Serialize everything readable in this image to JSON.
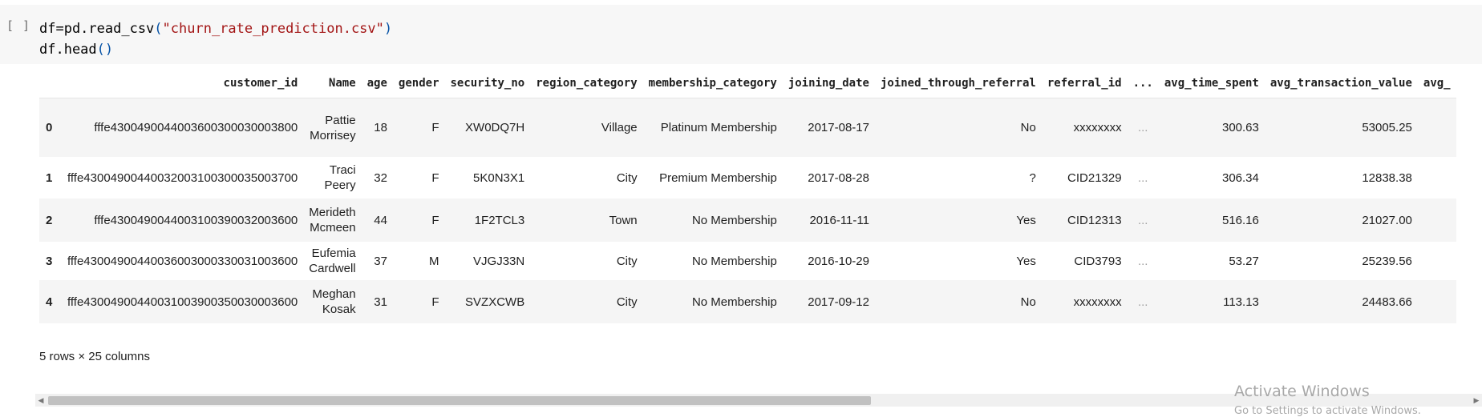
{
  "cell": {
    "run_indicator": "[ ]",
    "code": {
      "line1_pre": "df=pd.read_csv",
      "line1_open": "(",
      "line1_str": "\"churn_rate_prediction.csv\"",
      "line1_close": ")",
      "line2_pre": "df.head",
      "line2_parens": "()"
    }
  },
  "dataframe": {
    "columns": [
      "customer_id",
      "Name",
      "age",
      "gender",
      "security_no",
      "region_category",
      "membership_category",
      "joining_date",
      "joined_through_referral",
      "referral_id",
      "...",
      "avg_time_spent",
      "avg_transaction_value",
      "avg_"
    ],
    "rows": [
      {
        "index": "0",
        "customer_id": "fffe4300490044003600300030003800",
        "name1": "Pattie",
        "name2": "Morrisey",
        "age": "18",
        "gender": "F",
        "security_no": "XW0DQ7H",
        "region_category": "Village",
        "membership_category": "Platinum Membership",
        "joining_date": "2017-08-17",
        "joined_through_referral": "No",
        "referral_id": "xxxxxxxx",
        "ellipsis": "...",
        "avg_time_spent": "300.63",
        "avg_transaction_value": "53005.25"
      },
      {
        "index": "1",
        "customer_id": "fffe43004900440032003100300035003700",
        "name1": "Traci",
        "name2": "Peery",
        "age": "32",
        "gender": "F",
        "security_no": "5K0N3X1",
        "region_category": "City",
        "membership_category": "Premium Membership",
        "joining_date": "2017-08-28",
        "joined_through_referral": "?",
        "referral_id": "CID21329",
        "ellipsis": "...",
        "avg_time_spent": "306.34",
        "avg_transaction_value": "12838.38"
      },
      {
        "index": "2",
        "customer_id": "fffe4300490044003100390032003600",
        "name1": "Merideth",
        "name2": "Mcmeen",
        "age": "44",
        "gender": "F",
        "security_no": "1F2TCL3",
        "region_category": "Town",
        "membership_category": "No Membership",
        "joining_date": "2016-11-11",
        "joined_through_referral": "Yes",
        "referral_id": "CID12313",
        "ellipsis": "...",
        "avg_time_spent": "516.16",
        "avg_transaction_value": "21027.00"
      },
      {
        "index": "3",
        "customer_id": "fffe43004900440036003000330031003600",
        "name1": "Eufemia",
        "name2": "Cardwell",
        "age": "37",
        "gender": "M",
        "security_no": "VJGJ33N",
        "region_category": "City",
        "membership_category": "No Membership",
        "joining_date": "2016-10-29",
        "joined_through_referral": "Yes",
        "referral_id": "CID3793",
        "ellipsis": "...",
        "avg_time_spent": "53.27",
        "avg_transaction_value": "25239.56"
      },
      {
        "index": "4",
        "customer_id": "fffe43004900440031003900350030003600",
        "name1": "Meghan",
        "name2": "Kosak",
        "age": "31",
        "gender": "F",
        "security_no": "SVZXCWB",
        "region_category": "City",
        "membership_category": "No Membership",
        "joining_date": "2017-09-12",
        "joined_through_referral": "No",
        "referral_id": "xxxxxxxx",
        "ellipsis": "...",
        "avg_time_spent": "113.13",
        "avg_transaction_value": "24483.66"
      }
    ],
    "summary": "5 rows × 25 columns"
  },
  "scrollbar": {
    "left_arrow": "◀",
    "right_arrow": "▶"
  },
  "watermark": {
    "title": "Activate Windows",
    "subtitle": "Go to Settings to activate Windows."
  }
}
